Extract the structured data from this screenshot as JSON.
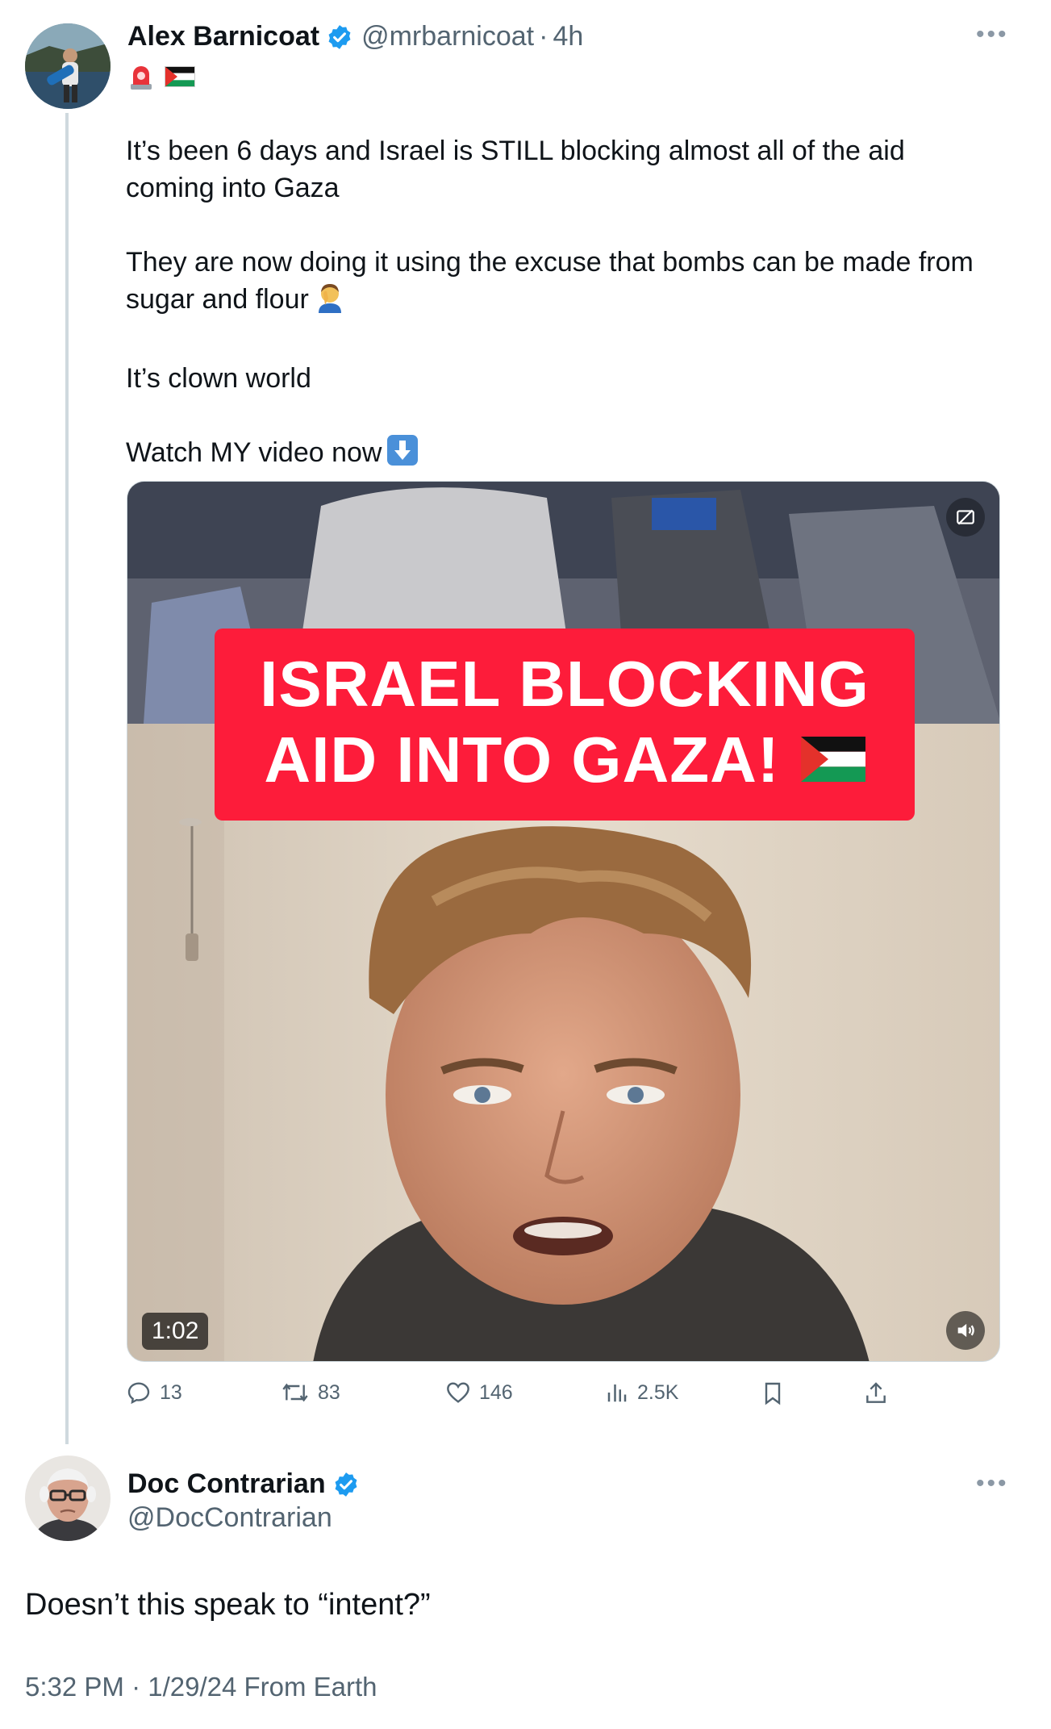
{
  "tweet": {
    "author_name": "Alex Barnicoat",
    "author_handle": "@mrbarnicoat",
    "separator": "·",
    "time_ago": "4h",
    "bio_emojis": [
      "rotating-light-emoji",
      "palestine-flag-emoji"
    ],
    "paragraphs": [
      "It’s been 6 days and Israel is STILL blocking almost all of the aid coming into Gaza",
      "They are now doing it using the excuse that bombs can be made from sugar and flour",
      "It’s clown world",
      "Watch MY video now"
    ],
    "paragraph_emojis": [
      "",
      "facepalm-emoji",
      "",
      "down-arrow-emoji"
    ],
    "video": {
      "banner_line1": "ISRAEL BLOCKING",
      "banner_line2": "AID INTO GAZA!",
      "duration": "1:02"
    },
    "stats": {
      "replies": "13",
      "reposts": "83",
      "likes": "146",
      "views": "2.5K"
    }
  },
  "reply": {
    "author_name": "Doc Contrarian",
    "author_handle": "@DocContrarian",
    "text": "Doesn’t this speak to “intent?”",
    "timestamp": "5:32 PM · 1/29/24 From Earth"
  },
  "colors": {
    "verified_blue": "#1d9bf0",
    "banner_red": "#fd1c3a",
    "secondary_text": "#536471",
    "thread_line": "#cfd9de"
  }
}
